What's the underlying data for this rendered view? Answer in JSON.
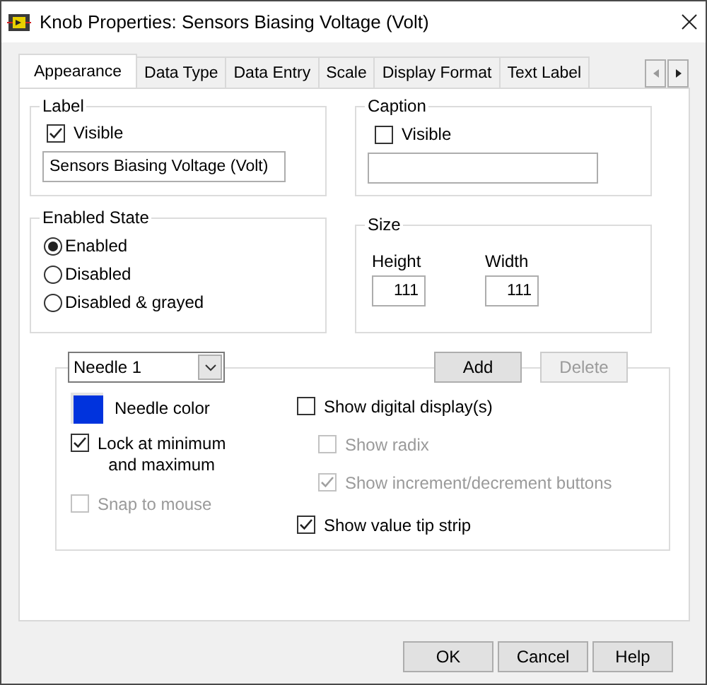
{
  "window": {
    "title": "Knob Properties: Sensors Biasing Voltage (Volt)"
  },
  "tabs": [
    {
      "label": "Appearance",
      "selected": true
    },
    {
      "label": "Data Type",
      "selected": false
    },
    {
      "label": "Data Entry",
      "selected": false
    },
    {
      "label": "Scale",
      "selected": false
    },
    {
      "label": "Display Format",
      "selected": false
    },
    {
      "label": "Text Label",
      "selected": false
    }
  ],
  "label_group": {
    "title": "Label",
    "visible": {
      "label": "Visible",
      "checked": true
    },
    "value": "Sensors Biasing Voltage (Volt)"
  },
  "caption_group": {
    "title": "Caption",
    "visible": {
      "label": "Visible",
      "checked": false
    }
  },
  "enabled_state": {
    "title": "Enabled State",
    "options": [
      {
        "label": "Enabled",
        "selected": true
      },
      {
        "label": "Disabled",
        "selected": false
      },
      {
        "label": "Disabled & grayed",
        "selected": false
      }
    ]
  },
  "size": {
    "title": "Size",
    "fields": [
      {
        "label": "Height",
        "value": "111"
      },
      {
        "label": "Width",
        "value": "111"
      }
    ]
  },
  "needles": {
    "dropdown": "Needle 1",
    "buttons": [
      {
        "label": "Add",
        "disabled": false
      },
      {
        "label": "Delete",
        "disabled": true
      }
    ],
    "color": {
      "label": "Needle color",
      "color": "#0033dd"
    },
    "left_options": [
      {
        "label": "Lock at minimum\nand maximum",
        "checked": true,
        "disabled": false
      },
      {
        "label": "Snap to mouse",
        "checked": false,
        "disabled": true
      }
    ],
    "right_options": [
      {
        "label": "Show digital display(s)",
        "checked": false,
        "disabled": false,
        "children": [
          {
            "label": "Show radix",
            "checked": false,
            "disabled": true
          },
          {
            "label": "Show increment/decrement buttons",
            "checked": true,
            "disabled": true
          }
        ]
      },
      {
        "label": "Show value tip strip",
        "checked": true,
        "disabled": false
      }
    ]
  },
  "buttons": [
    {
      "label": "OK"
    },
    {
      "label": "Cancel"
    },
    {
      "label": "Help"
    }
  ]
}
